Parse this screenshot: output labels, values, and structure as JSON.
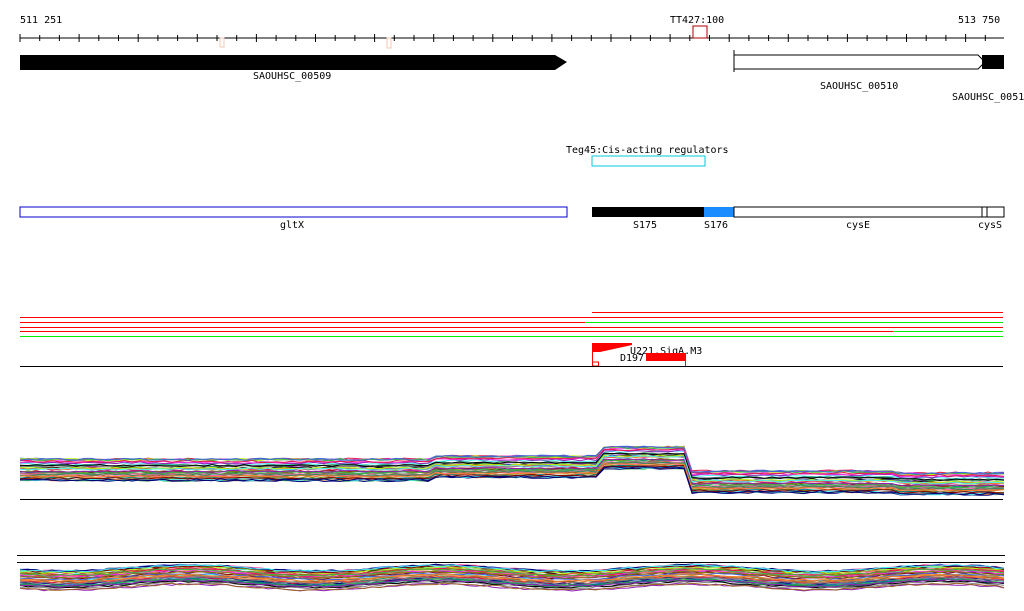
{
  "ruler": {
    "start_label": "511 251",
    "end_label": "513 750",
    "marker_label": "TT427:100",
    "marker_color": "#b00000"
  },
  "genes": [
    {
      "name": "SAOUHSC_00509",
      "strand": "+",
      "fill": "#000000"
    },
    {
      "name": "SAOUHSC_00510",
      "strand": "+",
      "fill": "#ffffff"
    },
    {
      "name": "SAOUHSC_0051",
      "strand": "+",
      "fill": "#000000"
    }
  ],
  "regulator": {
    "label": "Teg45:Cis-acting regulators",
    "color": "#00c8d8"
  },
  "operon_track": {
    "items": [
      {
        "name": "gltX",
        "color": "#0000cc",
        "fill": "#ffffff"
      },
      {
        "name": "S175",
        "color": "#000000",
        "fill": "#000000"
      },
      {
        "name": "S176",
        "color": "#1a8cff",
        "fill": "#1a8cff"
      },
      {
        "name": "cysE",
        "color": "#000000",
        "fill": "#ffffff"
      },
      {
        "name": "cysS",
        "color": "#000000",
        "fill": "#ffffff"
      }
    ]
  },
  "condition_lines": {
    "colors": {
      "up": "#ff0000",
      "down": "#00ee00"
    }
  },
  "features": {
    "labels": [
      "U221.SigA.M3",
      "D197"
    ],
    "color": "#ff0000"
  },
  "expression_tracks": {
    "palette": [
      "#e6194b",
      "#3cb44b",
      "#4363d8",
      "#f58231",
      "#911eb4",
      "#46f0f0",
      "#f032e6",
      "#bcf60c",
      "#008080",
      "#9a6324",
      "#800000",
      "#808000",
      "#000075",
      "#808080",
      "#000000",
      "#ff69b4",
      "#2e8b57"
    ]
  }
}
